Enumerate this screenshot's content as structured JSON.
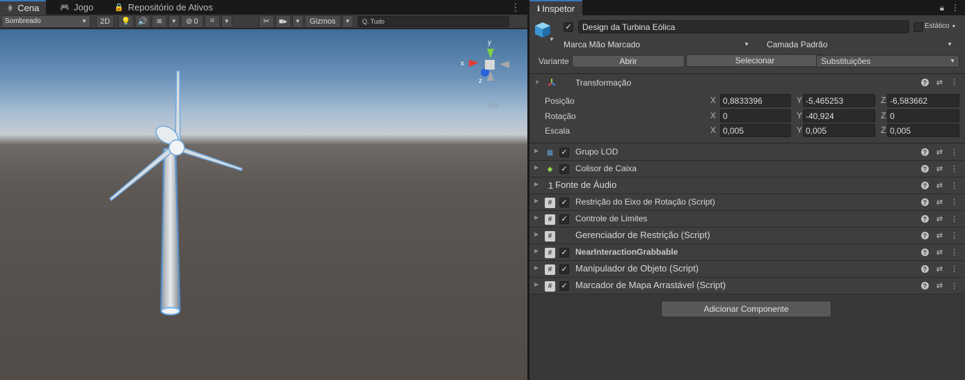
{
  "scene": {
    "tabs": [
      {
        "icon": "grid-icon",
        "label": "Cena"
      },
      {
        "icon": "gamepad-icon",
        "label": "Jogo"
      },
      {
        "icon": "lock-icon",
        "label": "Repositório de Ativos"
      }
    ],
    "toolbar": {
      "shading_mode": "Sombreado",
      "mode_2d": "2D",
      "hidden_count": "0",
      "gizmos": "Gizmos",
      "search": "Q. Tudo"
    },
    "gizmo": {
      "x_axis": "x",
      "y_axis": "y",
      "z_axis": "z",
      "projection": "Iso"
    }
  },
  "inspector": {
    "tab_label": "Inspetor",
    "object": {
      "name": "Design da Turbina Eólica",
      "active": true,
      "static_label": "Estático",
      "tag": "Marca Mão Marcado",
      "layer": "Camada Padrão"
    },
    "variant": {
      "label": "Variante",
      "open": "Abrir",
      "select": "Selecionar",
      "overrides": "Substituições"
    },
    "transform": {
      "title": "Transformação",
      "position": {
        "label": "Posição",
        "x": "0,8833396",
        "y": "-5,465253",
        "z": "-6,583662"
      },
      "rotation": {
        "label": "Rotação",
        "x": "0",
        "y": "-40,924",
        "z": "0"
      },
      "scale": {
        "label": "Escala",
        "x": "0,005",
        "y": "0,005",
        "z": "0,005"
      }
    },
    "components": [
      {
        "name": "Grupo LOD",
        "icon": "lod-group-icon",
        "checked": true
      },
      {
        "name": "Colisor de Caixa",
        "icon": "box-collider-icon",
        "checked": true
      },
      {
        "name": "Fonte de Áudio",
        "icon": "audio-source-icon",
        "checked": true,
        "prefix": "1"
      },
      {
        "name": "Restrição do Eixo de Rotação (Script)",
        "icon": "script-icon",
        "checked": true
      },
      {
        "name": "Controle de Limites",
        "icon": "script-icon",
        "checked": true
      },
      {
        "name": "Gerenciador de Restrição (Script)",
        "icon": "script-icon",
        "checked": false
      },
      {
        "name": "NearInteractionGrabbable",
        "icon": "script-icon",
        "checked": true
      },
      {
        "name": "Manipulador de Objeto (Script)",
        "icon": "script-icon",
        "checked": true
      },
      {
        "name": "Marcador de Mapa Arrastável (Script)",
        "icon": "script-icon",
        "checked": true
      }
    ],
    "add_component": "Adicionar Componente"
  }
}
